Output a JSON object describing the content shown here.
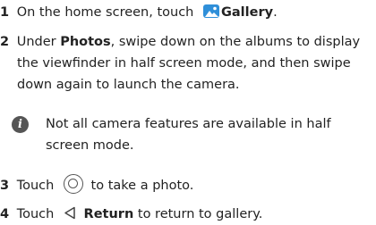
{
  "steps": [
    {
      "number": "1",
      "text_before": "On the home screen, touch",
      "icon": "gallery-icon",
      "emphasis": "Gallery",
      "text_after": "."
    },
    {
      "number": "2",
      "text_before": "Under",
      "emphasis": "Photos",
      "line1_rest": ", swipe down on the albums to display",
      "line2": "the viewfinder in half screen mode, and then swipe",
      "line3": "down again to launch the camera."
    },
    {
      "number": "3",
      "text_before": "Touch",
      "icon": "shutter-icon",
      "text_after": "to take a photo."
    },
    {
      "number": "4",
      "text_before": "Touch",
      "icon": "back-icon",
      "emphasis": "Return",
      "text_after": "to return to gallery."
    }
  ],
  "note": {
    "icon": "info-icon",
    "line1": "Not all camera features are available in half",
    "line2": "screen mode."
  },
  "colors": {
    "gallery_icon": "#2f8fd9",
    "info_icon": "#555555"
  }
}
